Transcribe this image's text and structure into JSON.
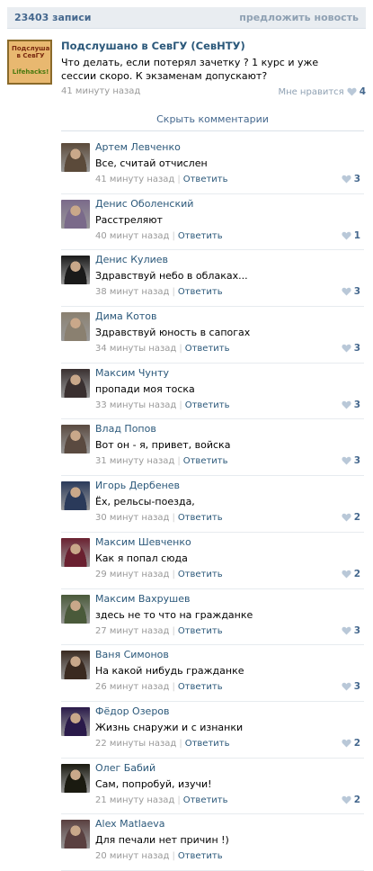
{
  "header": {
    "count": "23403 записи",
    "suggest": "предложить новость"
  },
  "post": {
    "group_name": "Подслушано в СевГУ (СевНТУ)",
    "avatar_text_top": "Подслушано в СевГУ",
    "avatar_text_bottom": "Lifehacks!",
    "text": "Что делать, если потерял зачетку ? 1 курс и уже сессии скоро. К экзаменам допускают?",
    "time": "41 минуту назад",
    "like_label": "Мне нравится",
    "likes": "4"
  },
  "hide_comments": "Скрыть комментарии",
  "reply_label": "Ответить",
  "colors": {
    "link": "#2b587a",
    "accent": "#45688e",
    "muted": "#999999",
    "heart": "#b9c8d8"
  },
  "comments": [
    {
      "author": "Артем Левченко",
      "text": "Все, считай отчислен",
      "time": "41 минуту назад",
      "likes": "3",
      "avatar_color": "#5b4a3a"
    },
    {
      "author": "Денис Оболенский",
      "text": "Расстреляют",
      "time": "40 минут назад",
      "likes": "1",
      "avatar_color": "#7a6a8a"
    },
    {
      "author": "Денис Кулиев",
      "text": "Здравствуй небо в облаках...",
      "time": "38 минут назад",
      "likes": "3",
      "avatar_color": "#1a1a1a"
    },
    {
      "author": "Дима Котов",
      "text": "Здравствуй юность в сапогах",
      "time": "34 минуты назад",
      "likes": "3",
      "avatar_color": "#8a8070"
    },
    {
      "author": "Максим Чунту",
      "text": "пропади моя тоска",
      "time": "33 минуты назад",
      "likes": "3",
      "avatar_color": "#3a3030"
    },
    {
      "author": "Влад Попов",
      "text": "Вот он - я, привет, войска",
      "time": "31 минуту назад",
      "likes": "3",
      "avatar_color": "#5a4a40"
    },
    {
      "author": "Игорь Дербенев",
      "text": "Ёх, рельсы-поезда,",
      "time": "30 минут назад",
      "likes": "2",
      "avatar_color": "#2a3a5a"
    },
    {
      "author": "Максим Шевченко",
      "text": "Как я попал сюда",
      "time": "29 минут назад",
      "likes": "2",
      "avatar_color": "#6a2030"
    },
    {
      "author": "Максим Вахрушев",
      "text": "здесь не то что на гражданке",
      "time": "27 минут назад",
      "likes": "3",
      "avatar_color": "#4a5a3a"
    },
    {
      "author": "Ваня Симонов",
      "text": "На какой нибудь гражданке",
      "time": "26 минут назад",
      "likes": "3",
      "avatar_color": "#3a2a20"
    },
    {
      "author": "Фёдор Озеров",
      "text": "Жизнь снаружи и с изнанки",
      "time": "22 минуты назад",
      "likes": "2",
      "avatar_color": "#2a1a4a"
    },
    {
      "author": "Олег Бабий",
      "text": "Сам, попробуй, изучи!",
      "time": "21 минуту назад",
      "likes": "2",
      "avatar_color": "#1a1a10"
    },
    {
      "author": "Alex Matlaeva",
      "text": "Для печали нет причин !)",
      "time": "20 минут назад",
      "likes": "",
      "avatar_color": "#5a4040"
    }
  ]
}
